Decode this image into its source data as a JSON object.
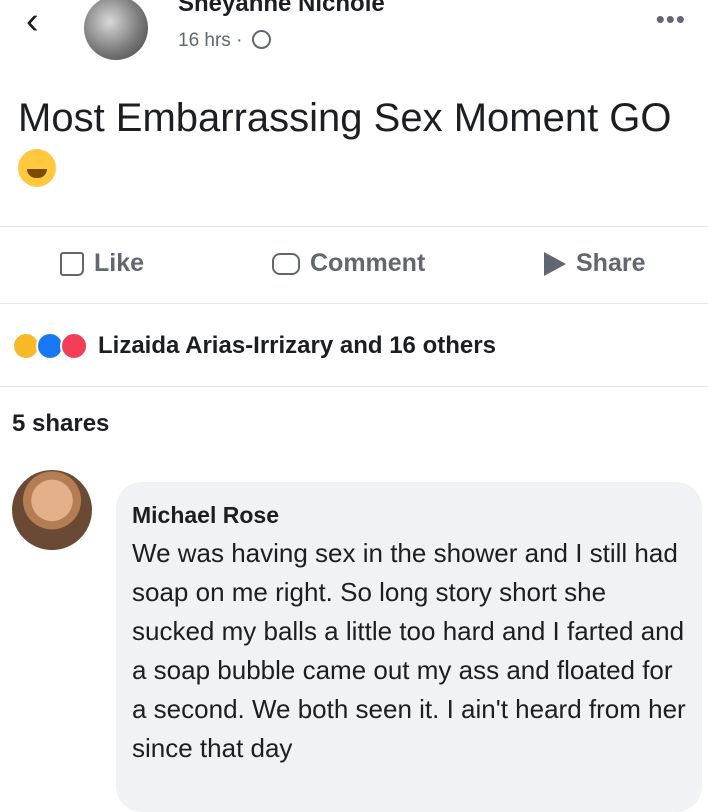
{
  "post": {
    "author": "Sheyanne Nichole",
    "time": "16 hrs",
    "separator": "·",
    "back_glyph": "‹",
    "more_glyph": "•••",
    "text": "Most Embarrassing Sex Moment GO",
    "emoji": "rolling-on-floor-laughing-emoji"
  },
  "actions": {
    "like": "Like",
    "comment": "Comment",
    "share": "Share"
  },
  "reactions": {
    "summary": "Lizaida Arias-Irrizary and 16 others",
    "icons": [
      "haha-icon",
      "like-icon",
      "love-icon"
    ],
    "colors": {
      "haha": "#f7b928",
      "like": "#1877f2",
      "love": "#f33e58"
    }
  },
  "shares": "5 shares",
  "comment": {
    "name": "Michael Rose",
    "text": "We was having sex in the shower and I still had soap on me right. So long story short she sucked my balls a little too hard and I farted and a soap bubble came out my ass and floated for a second. We both seen it. I ain't heard from her since that day"
  }
}
